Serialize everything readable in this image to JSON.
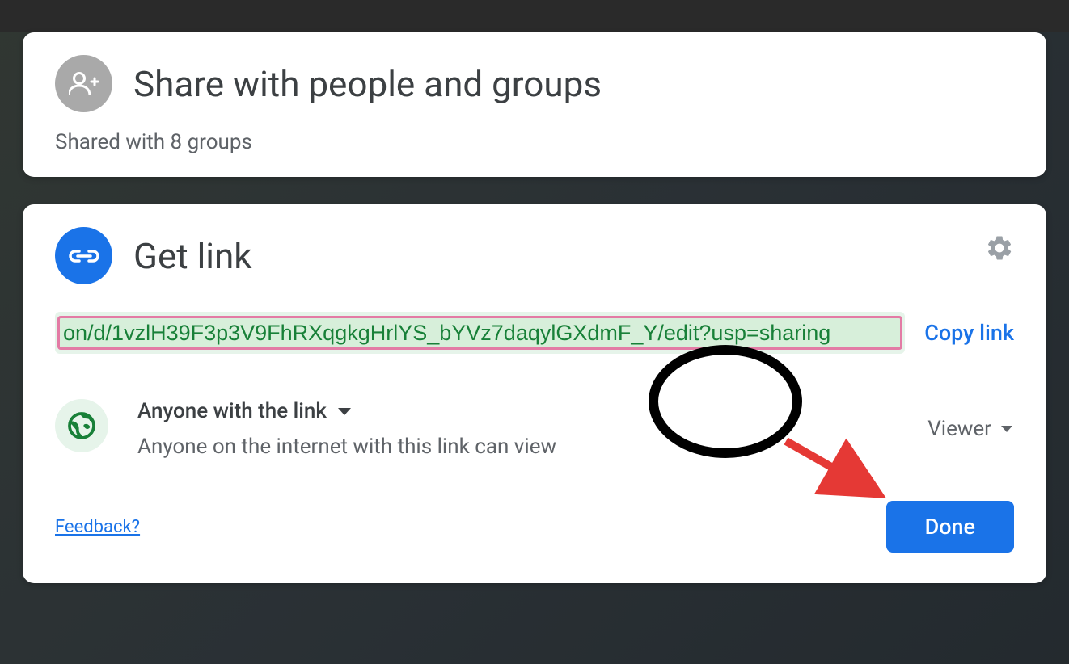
{
  "share_panel": {
    "title": "Share with people and groups",
    "shared_with": "Shared with 8 groups"
  },
  "link_panel": {
    "title": "Get link",
    "url_text": "on/d/1vzlH39F3p3V9FhRXqgkgHrlYS_bYVz7daqylGXdmF_Y/edit?usp=sharing",
    "copy_label": "Copy link",
    "scope_label": "Anyone with the link",
    "scope_description": "Anyone on the internet with this link can view",
    "role": "Viewer",
    "feedback_label": "Feedback?",
    "done_label": "Done"
  },
  "icons": {
    "person_add": "person-add-icon",
    "link": "link-icon",
    "gear": "gear-icon",
    "globe": "globe-icon"
  }
}
